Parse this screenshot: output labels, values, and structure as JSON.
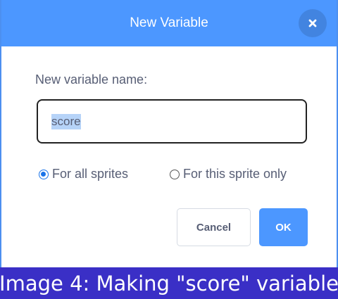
{
  "dialog": {
    "title": "New Variable",
    "close_icon": "close-x-icon",
    "name_label": "New variable name:",
    "name_value": "score",
    "scope_options": [
      {
        "label": "For all sprites",
        "checked": true
      },
      {
        "label": "For this sprite only",
        "checked": false
      }
    ],
    "cancel_label": "Cancel",
    "ok_label": "OK"
  },
  "caption": {
    "text": "Image 4: Making \"score\" variable"
  },
  "colors": {
    "header": "#4c97ff",
    "ok_button": "#4c97ff",
    "caption_bar": "#3a2fc6",
    "text": "#575e75",
    "selection": "#b6d3f8"
  }
}
